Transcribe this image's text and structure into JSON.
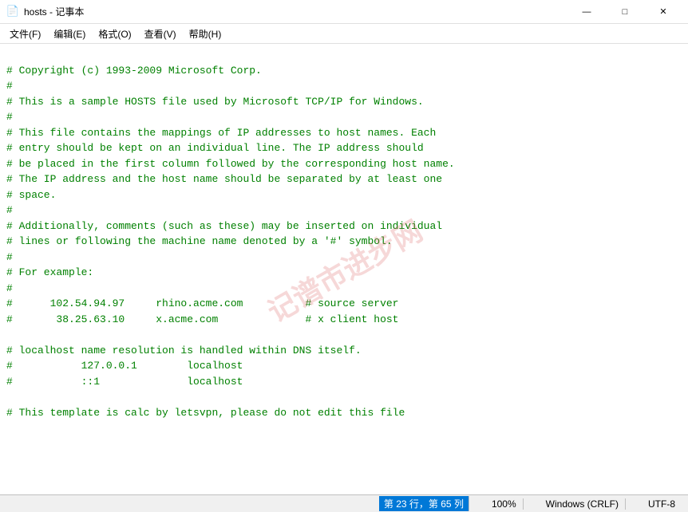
{
  "titlebar": {
    "title": "hosts - 记事本",
    "icon": "📄",
    "minimize": "—",
    "maximize": "□",
    "close": "✕"
  },
  "menubar": {
    "items": [
      "文件(F)",
      "编辑(E)",
      "格式(O)",
      "查看(V)",
      "帮助(H)"
    ]
  },
  "content": {
    "lines": [
      "# Copyright (c) 1993-2009 Microsoft Corp.",
      "#",
      "# This is a sample HOSTS file used by Microsoft TCP/IP for Windows.",
      "#",
      "# This file contains the mappings of IP addresses to host names. Each",
      "# entry should be kept on an individual line. The IP address should",
      "# be placed in the first column followed by the corresponding host name.",
      "# The IP address and the host name should be separated by at least one",
      "# space.",
      "#",
      "# Additionally, comments (such as these) may be inserted on individual",
      "# lines or following the machine name denoted by a '#' symbol.",
      "#",
      "# For example:",
      "#",
      "#\t102.54.94.97\trhino.acme.com\t\t# source server",
      "#\t 38.25.63.10\tx.acme.com\t\t\t# x client host",
      "",
      "# localhost name resolution is handled within DNS itself.",
      "#\t\t127.0.0.1\t\tlocalhost",
      "#\t\t::1\t\t\t\tlocalhost",
      "",
      "# This template is calc by letsvpn, please do not edit this file"
    ]
  },
  "watermark": {
    "text": "记谱市进步网",
    "display": "记谱市进步网"
  },
  "statusbar": {
    "position": "第 23 行，第 65 列",
    "zoom": "100%",
    "line_ending": "Windows (CRLF)",
    "encoding": "UTF-8"
  }
}
